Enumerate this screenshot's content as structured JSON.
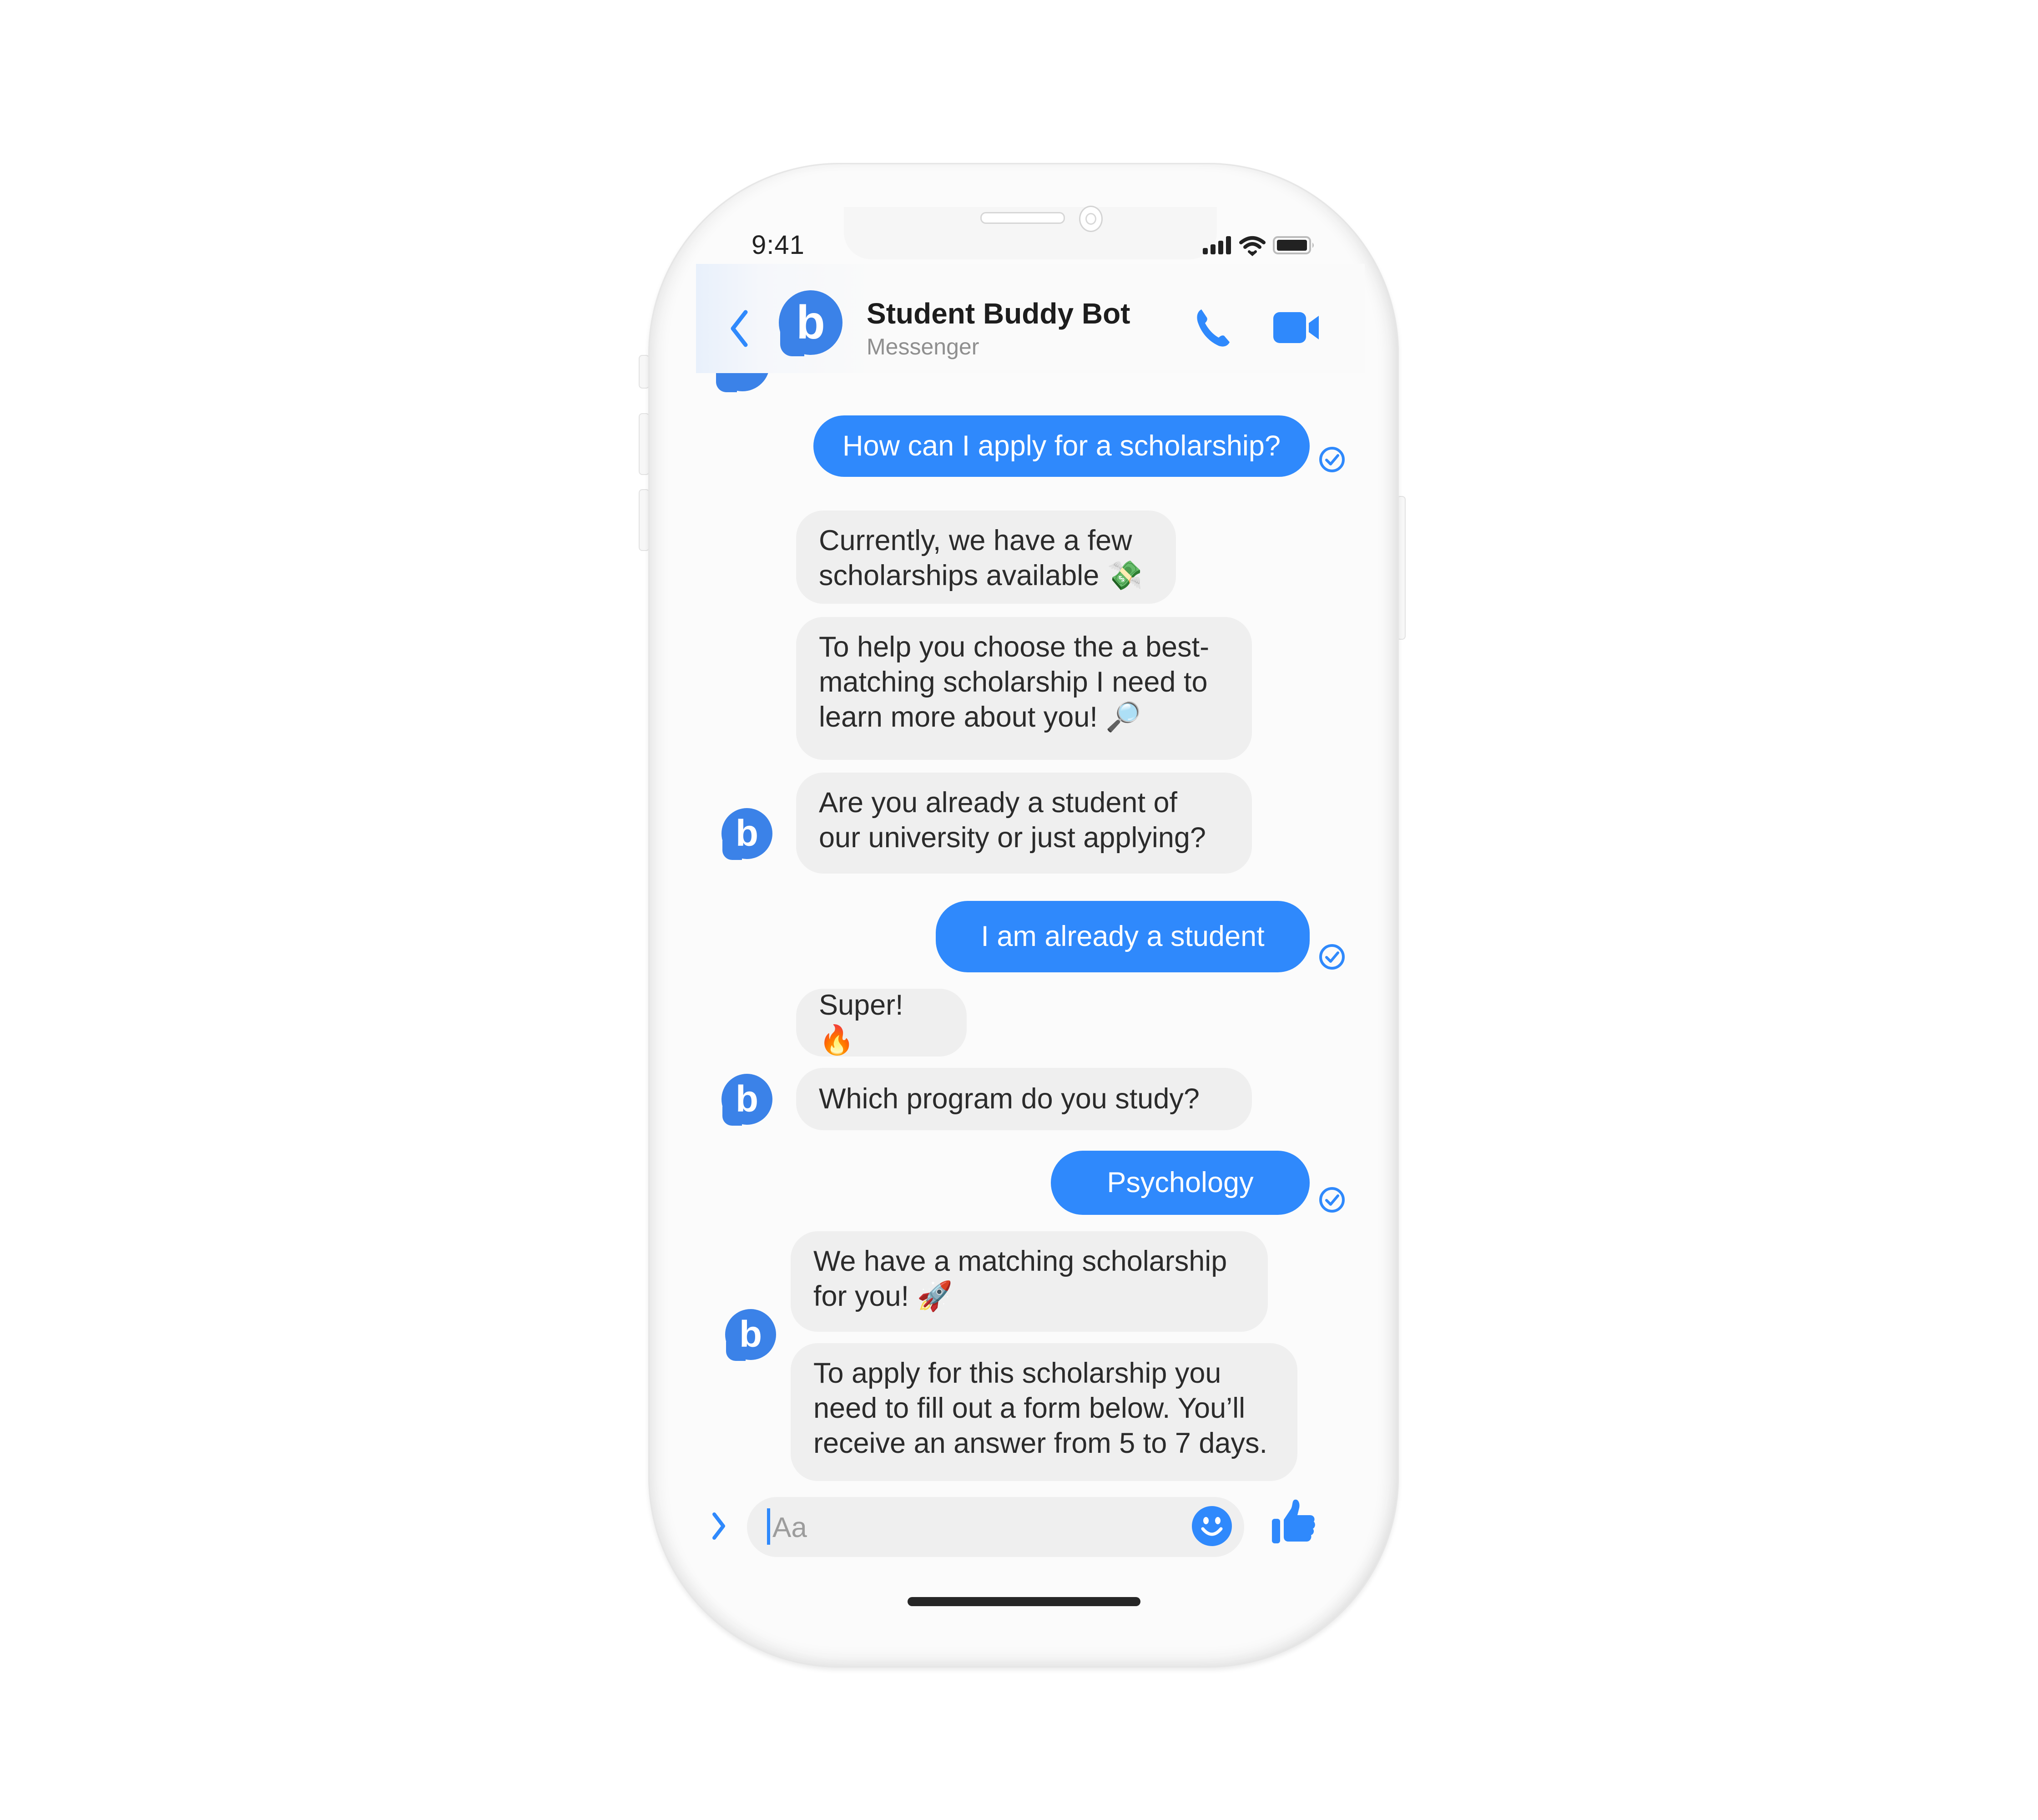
{
  "status_bar": {
    "time": "9:41",
    "icons": [
      "signal-icon",
      "wifi-icon",
      "battery-icon"
    ]
  },
  "header": {
    "back_icon": "chevron-left-icon",
    "avatar_letter": "b",
    "title": "Student Buddy Bot",
    "subtitle": "Messenger",
    "call_icon": "phone-icon",
    "video_icon": "video-camera-icon"
  },
  "messages": [
    {
      "sender": "user",
      "text": "How can I apply for a scholarship?",
      "status": "delivered"
    },
    {
      "sender": "bot",
      "lines": [
        "Currently, we have a few",
        "scholarships available 💸"
      ]
    },
    {
      "sender": "bot",
      "lines": [
        "To help you choose the a best-",
        "matching scholarship I need to",
        "learn more about you! 🔎"
      ]
    },
    {
      "sender": "bot",
      "lines": [
        "Are you already a student of",
        "our university or just applying?"
      ]
    },
    {
      "sender": "user",
      "text": "I am already a student",
      "status": "delivered"
    },
    {
      "sender": "bot",
      "lines": [
        "Super! 🔥"
      ]
    },
    {
      "sender": "bot",
      "lines": [
        "Which program do you study?"
      ]
    },
    {
      "sender": "user",
      "text": "Psychology",
      "status": "delivered"
    },
    {
      "sender": "bot",
      "lines": [
        "We have a matching scholarship",
        "for you! 🚀"
      ]
    },
    {
      "sender": "bot",
      "lines": [
        "To apply for this scholarship you",
        "need to fill out a form below. You’ll",
        "receive an answer from 5 to 7 days."
      ]
    }
  ],
  "composer": {
    "placeholder": "Aa",
    "value": "",
    "expand_icon": "chevron-right-icon",
    "emoji_icon": "smiley-icon",
    "like_icon": "thumbs-up-icon"
  },
  "colors": {
    "accent": "#2f89fc",
    "bot_avatar": "#3b82e8",
    "bot_bubble": "#efefef",
    "text_dark": "#2b2b2b",
    "subtitle_gray": "#8f8f8f"
  }
}
